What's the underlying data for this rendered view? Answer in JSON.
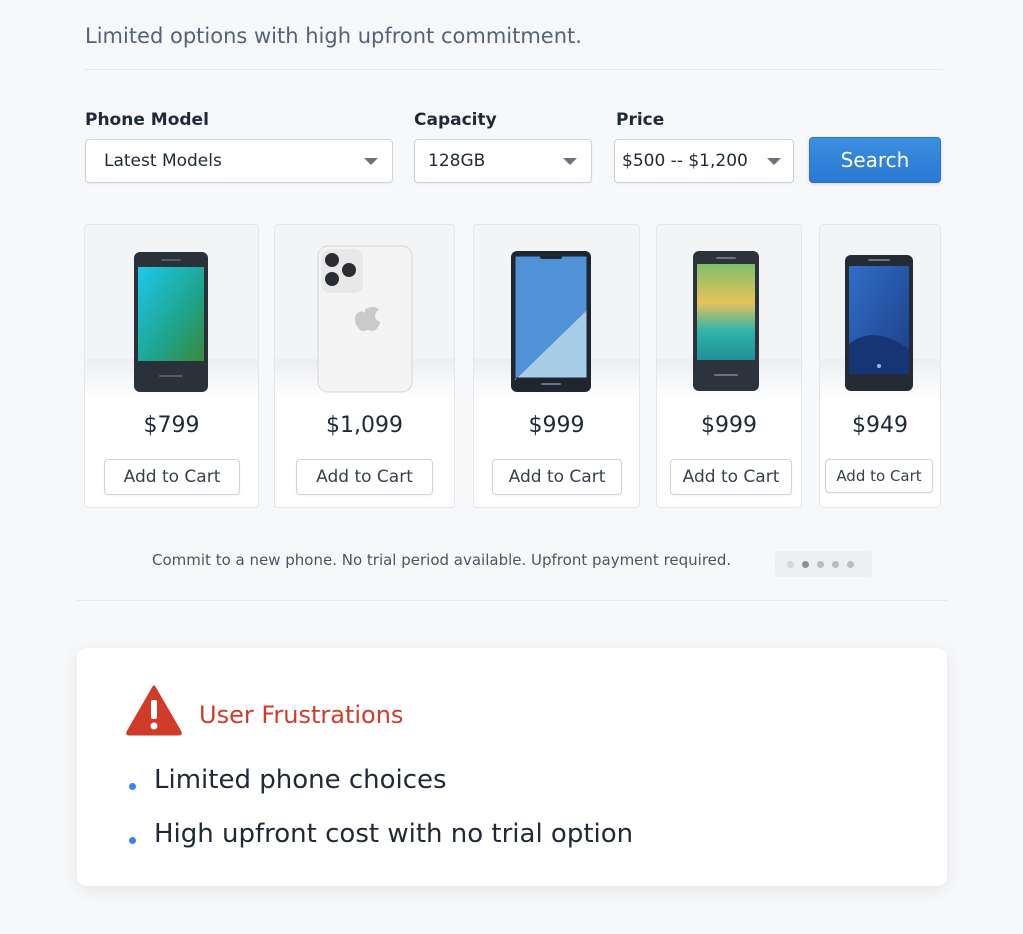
{
  "header": {
    "subtitle": "Limited options with high upfront commitment."
  },
  "filters": {
    "phone_model": {
      "label": "Phone Model",
      "value": "Latest Models"
    },
    "capacity": {
      "label": "Capacity",
      "value": "128GB"
    },
    "price": {
      "label": "Price",
      "value": "$500 -- $1,200"
    },
    "search_label": "Search"
  },
  "products": [
    {
      "price": "$799",
      "cart_label": "Add to Cart"
    },
    {
      "price": "$1,099",
      "cart_label": "Add to Cart"
    },
    {
      "price": "$999",
      "cart_label": "Add to Cart"
    },
    {
      "price": "$999",
      "cart_label": "Add to Cart"
    },
    {
      "price": "$949",
      "cart_label": "Add to Cart"
    }
  ],
  "note": "Commit to a new phone. No trial period available. Upfront payment required.",
  "pagination": {
    "total": 5,
    "active": 1
  },
  "frustrations": {
    "title": "User Frustrations",
    "icon": "warning-icon",
    "items": [
      "Limited phone choices",
      "High upfront cost with no trial option"
    ]
  },
  "colors": {
    "accent": "#2a78d2",
    "warning": "#d13b29",
    "bullet": "#3b82f6"
  }
}
